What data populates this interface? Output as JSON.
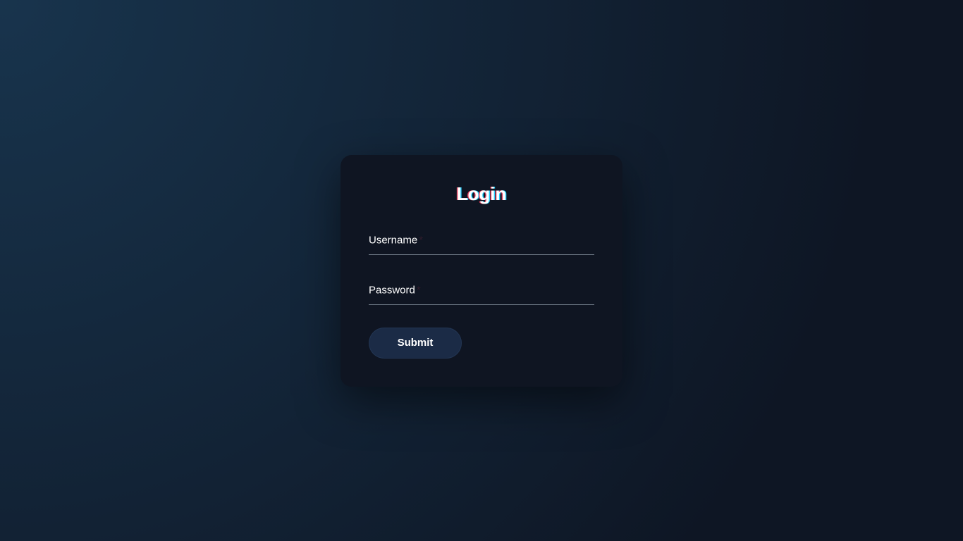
{
  "login": {
    "title": "Login",
    "username_label": "Username",
    "username_value": "",
    "password_label": "Password",
    "password_value": "",
    "required_mark": "*",
    "submit_label": "Submit"
  }
}
